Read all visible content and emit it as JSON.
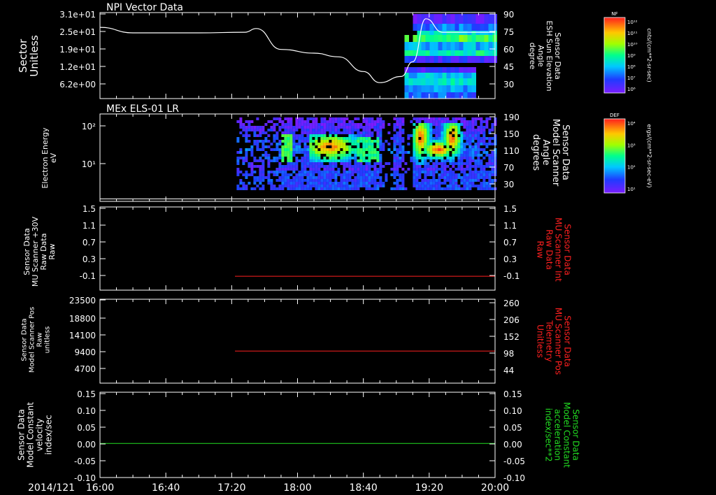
{
  "date_label": "2014/121",
  "time_ticks": [
    "16:00",
    "16:40",
    "17:20",
    "18:00",
    "18:40",
    "19:20",
    "20:00"
  ],
  "colors": {
    "red": "#ff2020",
    "green": "#22dd22",
    "white": "#ffffff"
  },
  "panels": [
    {
      "title": "NPI Vector Data",
      "left_label": [
        "Sector",
        "Unitless"
      ],
      "left_ticks": [
        "3.1e+01",
        "2.5e+01",
        "1.9e+01",
        "1.2e+01",
        "6.2e+00"
      ],
      "right_label": [
        "Sensor Data",
        "ESH Sun Elevation",
        "Angle",
        "degree"
      ],
      "right_ticks": [
        "90",
        "75",
        "60",
        "45",
        "30"
      ],
      "colorbar": {
        "tag": "NF",
        "units": "cnts/(cm**2-sr-sec)",
        "ticks": [
          "10¹²",
          "10¹¹",
          "10¹⁰",
          "10⁹",
          "10⁸",
          "10⁷",
          "10⁶"
        ]
      }
    },
    {
      "title": "MEx ELS-01 LR",
      "left_label": [
        "Electron Energy",
        "eV"
      ],
      "left_ticks": [
        "10²",
        "10¹"
      ],
      "right_label": [
        "Sensor Data",
        "Model Scanner",
        "Angle",
        "degrees"
      ],
      "right_ticks": [
        "190",
        "150",
        "110",
        "70",
        "30"
      ],
      "colorbar": {
        "tag": "DEF",
        "units": "ergs/(cm**2-sr-sec-eV)",
        "ticks": [
          "10⁴",
          "10³",
          "10²",
          "10¹"
        ]
      }
    },
    {
      "title": "",
      "left_label": [
        "Sensor Data",
        "MU Scanner +30V",
        "Raw Data",
        "Raw"
      ],
      "left_ticks": [
        "1.5",
        "1.1",
        "0.7",
        "0.3",
        "-0.1"
      ],
      "right_label": [
        "Sensor Data",
        "MU Scanner Int",
        "Raw Data",
        "Raw"
      ],
      "right_ticks": [
        "1.5",
        "1.1",
        "0.7",
        "0.3",
        "-0.1"
      ]
    },
    {
      "title": "",
      "left_label": [
        "Sensor Data",
        "Model Scanner Pos",
        "Raw",
        "unitless"
      ],
      "left_ticks": [
        "23500",
        "18800",
        "14100",
        "9400",
        "4700"
      ],
      "right_label": [
        "Sensor Data",
        "MU Scanner Pos",
        "Telemetry",
        "Unitless"
      ],
      "right_ticks": [
        "260",
        "206",
        "152",
        "98",
        "44"
      ]
    },
    {
      "title": "",
      "left_label": [
        "Sensor Data",
        "Model Constant",
        "velocity",
        "index/sec"
      ],
      "left_ticks": [
        "0.15",
        "0.10",
        "0.05",
        "0.00",
        "-0.05",
        "-0.10"
      ],
      "right_label": [
        "Sensor Data",
        "Model Constant",
        "acceleration",
        "index/sec**2"
      ],
      "right_ticks": [
        "0.15",
        "0.10",
        "0.05",
        "0.00",
        "-0.05",
        "-0.10"
      ]
    }
  ],
  "chart_data": [
    {
      "type": "line",
      "title": "NPI Vector Data",
      "x_range": [
        "16:00",
        "20:00"
      ],
      "ylabel": "Sector Unitless",
      "y2label": "Sensor Data ESH Sun Elevation Angle degree",
      "y2lim": [
        20,
        90
      ],
      "series": [
        {
          "name": "Sensor Data ESH Sun Elevation Angle",
          "x": [
            "16:00",
            "16:20",
            "17:00",
            "17:28",
            "17:35",
            "17:50",
            "18:10",
            "18:25",
            "18:40",
            "18:50",
            "19:03",
            "19:10",
            "19:18",
            "19:28",
            "20:00"
          ],
          "y": [
            78,
            73.5,
            73.5,
            74,
            77,
            60,
            57,
            54,
            42,
            33,
            38,
            50,
            85,
            74,
            74
          ]
        }
      ],
      "spectrogram": {
        "x_start": "19:05",
        "x_end": "20:00",
        "z_tag": "NF"
      }
    },
    {
      "type": "heatmap",
      "title": "MEx ELS-01 LR",
      "x_range": [
        "16:00",
        "20:00"
      ],
      "ylabel": "Electron Energy eV",
      "y_scale": "log",
      "y2label": "Sensor Data Model Scanner Angle degrees",
      "y2lim": [
        10,
        190
      ],
      "spectrogram": {
        "x_start": "17:23",
        "x_end": "20:00",
        "z_tag": "DEF"
      },
      "series": [
        {
          "name": "Sensor Data Model Scanner Angle",
          "x": [
            "16:00",
            "20:00"
          ],
          "y": [
            15,
            15
          ]
        }
      ]
    },
    {
      "type": "line",
      "ylabel": "Sensor Data MU Scanner +30V Raw Data Raw",
      "y2label": "Sensor Data MU Scanner Int Raw Data Raw",
      "ylim": [
        -0.3,
        1.5
      ],
      "series": [
        {
          "name": "Sensor Data MU Scanner Int Raw Data",
          "color": "#ff2020",
          "x": [
            "17:22",
            "20:00"
          ],
          "y": [
            0,
            0
          ]
        }
      ]
    },
    {
      "type": "line",
      "ylabel": "Sensor Data Model Scanner Pos Raw unitless",
      "y2label": "Sensor Data MU Scanner Pos Telemetry Unitless",
      "ylim": [
        0,
        23500
      ],
      "y2lim": [
        17,
        260
      ],
      "series": [
        {
          "name": "Sensor Data MU Scanner Pos Telemetry",
          "color": "#ff2020",
          "x": [
            "17:22",
            "20:00"
          ],
          "y": [
            110,
            110
          ]
        }
      ]
    },
    {
      "type": "line",
      "ylabel": "Sensor Data Model Constant velocity index/sec",
      "y2label": "Sensor Data Model Constant acceleration index/sec**2",
      "ylim": [
        -0.1,
        0.15
      ],
      "series": [
        {
          "name": "Sensor Data Model Constant acceleration",
          "color": "#22dd22",
          "x": [
            "16:00",
            "20:00"
          ],
          "y": [
            0,
            0
          ]
        }
      ]
    }
  ]
}
